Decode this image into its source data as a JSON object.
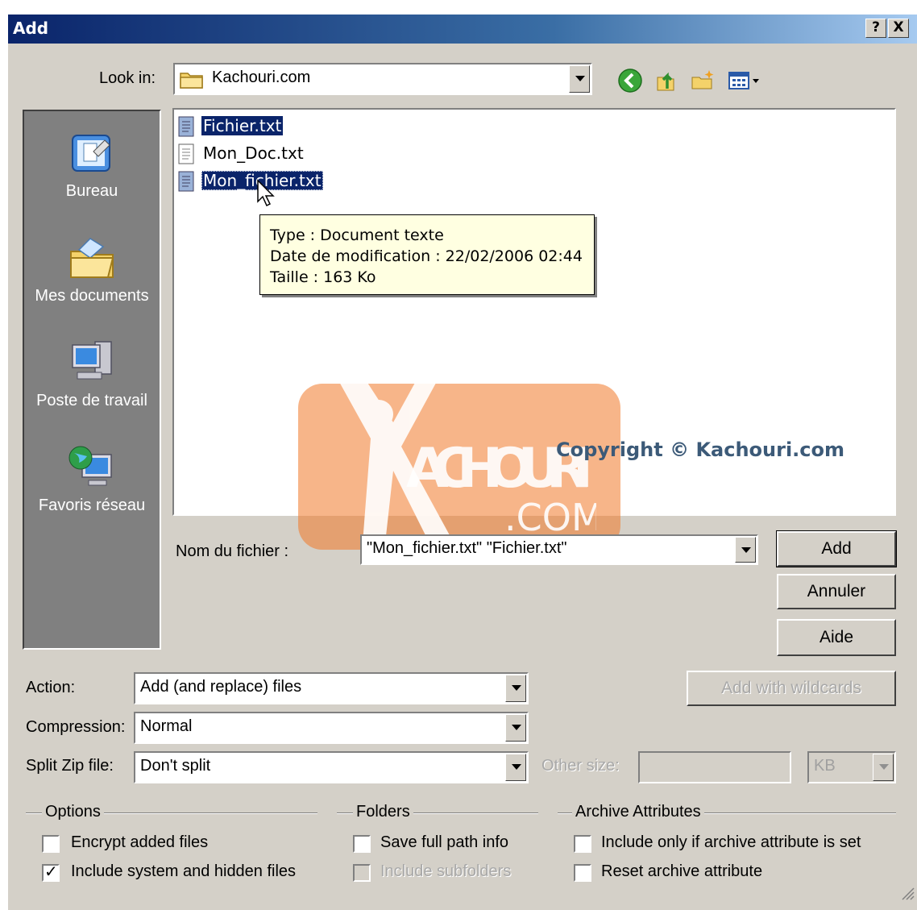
{
  "window": {
    "title": "Add",
    "help_btn": "?",
    "close_btn": "X"
  },
  "lookin": {
    "label": "Look in:",
    "value": "Kachouri.com"
  },
  "toolbar": {
    "icons": [
      "back-icon",
      "up-folder-icon",
      "new-folder-icon",
      "view-menu-icon"
    ]
  },
  "places": [
    {
      "label": "Bureau",
      "icon": "desktop-icon"
    },
    {
      "label": "Mes documents",
      "icon": "my-documents-icon"
    },
    {
      "label": "Poste de travail",
      "icon": "my-computer-icon"
    },
    {
      "label": "Favoris réseau",
      "icon": "network-places-icon"
    }
  ],
  "files": [
    {
      "name": "Fichier.txt",
      "selected": true
    },
    {
      "name": "Mon_Doc.txt",
      "selected": false
    },
    {
      "name": "Mon_fichier.txt",
      "selected": true
    }
  ],
  "tooltip": {
    "type": "Type : Document texte",
    "date": "Date de modification : 22/02/2006 02:44",
    "size": "Taille  : 163 Ko"
  },
  "watermark": {
    "brand": "ACHOURI",
    "suffix": ".COM",
    "copyright": "Copyright © Kachouri.com"
  },
  "filename": {
    "label": "Nom du fichier :",
    "value": "\"Mon_fichier.txt\" \"Fichier.txt\""
  },
  "buttons": {
    "add": "Add",
    "cancel": "Annuler",
    "help": "Aide",
    "wildcards": "Add with wildcards"
  },
  "action": {
    "label": "Action:",
    "value": "Add (and replace) files"
  },
  "compression": {
    "label": "Compression:",
    "value": "Normal"
  },
  "split": {
    "label": "Split Zip file:",
    "value": "Don't split",
    "other_label": "Other size:",
    "unit": "KB"
  },
  "options": {
    "title": "Options",
    "encrypt": {
      "label": "Encrypt added files",
      "checked": false
    },
    "system": {
      "label": "Include system and hidden files",
      "checked": true
    }
  },
  "folders": {
    "title": "Folders",
    "fullpath": {
      "label": "Save full path info",
      "checked": false
    },
    "subfolders": {
      "label": "Include subfolders",
      "checked": false,
      "disabled": true
    }
  },
  "attributes": {
    "title": "Archive Attributes",
    "only_if": {
      "label": "Include only if archive attribute is set",
      "checked": false
    },
    "reset": {
      "label": "Reset archive attribute",
      "checked": false
    }
  }
}
